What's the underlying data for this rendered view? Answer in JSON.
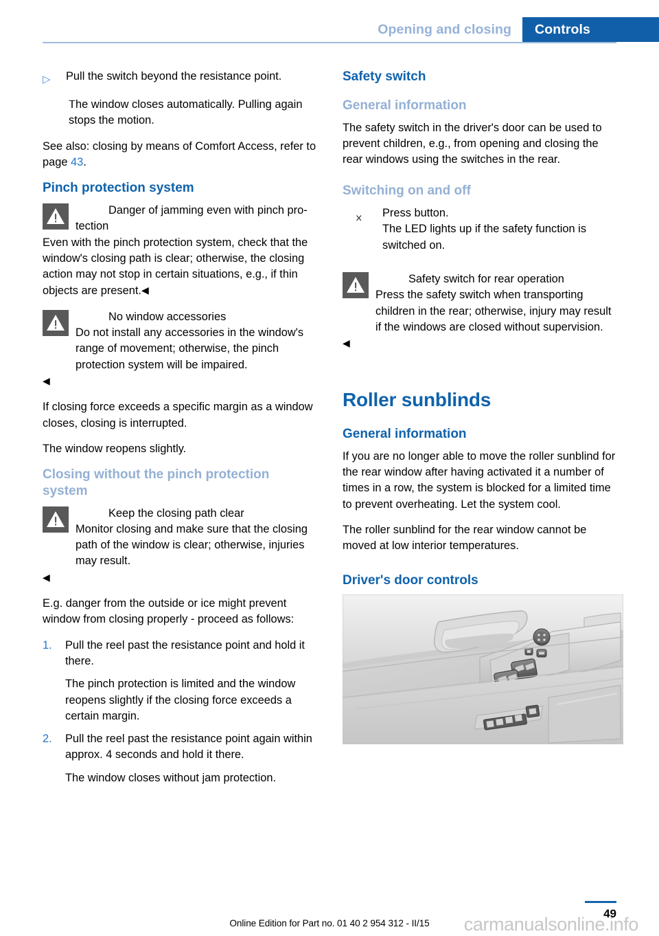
{
  "header": {
    "section": "Opening and closing",
    "chapter": "Controls"
  },
  "left_column": {
    "bullet_item": {
      "marker": "▷",
      "icon": "door-window-switch-icon",
      "text": "Pull the switch beyond the resistance point.",
      "result": "The window closes automatically. Pulling again stops the motion."
    },
    "see_also_prefix": "See also: closing by means of Comfort Access, refer to page ",
    "see_also_page": "43",
    "see_also_suffix": ".",
    "pinch_heading": "Pinch protection system",
    "warning1": {
      "icon": "warning-triangle-icon",
      "title": "Danger of jamming even with pinch pro-tection",
      "body": "Even with the pinch protection system, check that the window's closing path is clear; otherwise, the closing action may not stop in certain situations, e.g., if thin objects are present.",
      "end_marker": "◀"
    },
    "warning2": {
      "icon": "warning-triangle-icon",
      "title": "No window accessories",
      "body": "Do not install any accessories in the window's range of movement; otherwise, the pinch protection system will be impaired.",
      "end_marker": "◀"
    },
    "para_force": "If closing force exceeds a specific margin as a window closes, closing is interrupted.",
    "para_reopen": "The window reopens slightly.",
    "closing_heading": "Closing without the pinch protection system",
    "warning3": {
      "icon": "warning-triangle-icon",
      "title": "Keep the closing path clear",
      "body": "Monitor closing and make sure that the closing path of the window is clear; otherwise, injuries may result.",
      "end_marker": "◀"
    },
    "para_eg": "E.g. danger from the outside or ice might prevent window from closing properly - proceed as follows:",
    "steps": [
      {
        "number": "1.",
        "text": "Pull the reel past the resistance point and hold it there.",
        "result": "The pinch protection is limited and the window reopens slightly if the closing force exceeds a certain margin."
      },
      {
        "number": "2.",
        "text": "Pull the reel past the resistance point again within approx. 4 seconds and hold it there.",
        "result": "The window closes without jam protection."
      }
    ]
  },
  "right_column": {
    "safety_heading": "Safety switch",
    "general_info_heading": "General information",
    "general_info_body": "The safety switch in the driver's door can be used to prevent children, e.g., from opening and closing the rear windows using the switches in the rear.",
    "switching_heading": "Switching on and off",
    "press_button": {
      "icon": "safety-switch-button-icon",
      "text": "Press button.",
      "result": "The LED lights up if the safety function is switched on."
    },
    "warning4": {
      "icon": "warning-triangle-icon",
      "title": "Safety switch for rear operation",
      "body": "Press the safety switch when transporting children in the rear; otherwise, injury may result if the windows are closed without supervision.",
      "end_marker": "◀"
    },
    "roller_title": "Roller sunblinds",
    "roller_general_heading": "General information",
    "roller_general_body": "If you are no longer able to move the roller sunblind for the rear window after having activated it a number of times in a row, the system is blocked for a limited time to prevent overheating. Let the system cool.",
    "roller_temp_body": "The roller sunblind for the rear window cannot be moved at low interior temperatures.",
    "door_controls_heading": "Driver's door controls",
    "door_image_alt": "drivers-door-panel-illustration"
  },
  "footer": {
    "note": "Online Edition for Part no. 01 40 2 954 312 - II/15",
    "page_number": "49",
    "watermark": "carmanualsonline.info"
  },
  "colors": {
    "heading_blue": "#0f62ab",
    "subheading_blue": "#94b0d4",
    "tab_blue": "#115fa8",
    "tab_text_blue": "#96b2d8",
    "link_blue": "#2277cc",
    "rule_blue": "#9dbbdc",
    "warn_icon_gray": "#595959"
  }
}
